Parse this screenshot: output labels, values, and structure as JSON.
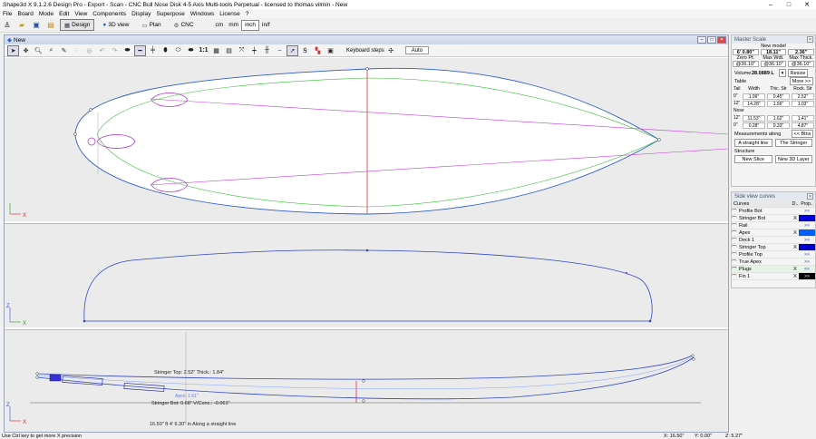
{
  "window": {
    "title": "Shape3d X 9.1.2.6 Design Pro - Export - Scan - CNC Bull Nose Disk 4-5 Axis Multi-tools Perpetual - licensed to thomas vilmin - New",
    "minimize": "–",
    "maximize": "□",
    "close": "✕"
  },
  "menu": [
    "File",
    "Board",
    "Mode",
    "Edit",
    "View",
    "Components",
    "Display",
    "Superpose",
    "Windows",
    "License",
    "?"
  ],
  "toolbar": {
    "modes": [
      {
        "label": "Design",
        "icon": "design-icon",
        "active": true
      },
      {
        "label": "3D view",
        "icon": "globe-icon",
        "active": false
      },
      {
        "label": "Plan",
        "icon": "plan-icon",
        "active": false
      },
      {
        "label": "CNC",
        "icon": "cnc-icon",
        "active": false
      }
    ],
    "units": [
      {
        "label": "cm",
        "active": false
      },
      {
        "label": "mm",
        "active": false
      },
      {
        "label": "inch",
        "active": true
      },
      {
        "label": "in/f",
        "active": false
      }
    ]
  },
  "document": {
    "tab_label": "New",
    "scale_label": "1:1",
    "keyboard_steps_label": "Keyboard steps",
    "auto_label": "Auto"
  },
  "views": {
    "outline_axis": "X",
    "profile_axis_x": "X",
    "profile_axis_z": "Z",
    "rocker_axis_x": "X",
    "rocker_axis_z": "Z",
    "rocker_text_top": "Stringer Top: 2.52\" Thick.: 1.84\"",
    "rocker_text_apex": "Apex: 1.61\"",
    "rocker_text_bot": "Stringer Bot: 0.68\" V/Conc.: -0.061\"",
    "rocker_footer": "16.50\" ft 4' 6.30\" in Along a straight line"
  },
  "master_scale": {
    "title": "Master Scale",
    "new_model": "New model",
    "values": [
      {
        "label": "Zero Pt.",
        "value": "6' 0.80\"",
        "sub": "@36.10\""
      },
      {
        "label": "Max Wdt.",
        "value": "18.11\"",
        "sub": "@36.10\""
      },
      {
        "label": "Max Thick.",
        "value": "2.36\"",
        "sub": "@36.10\""
      }
    ],
    "volume_label": "Volume",
    "volume_value": "28.0889 L",
    "resize": "Resize",
    "table_label": "Table",
    "more": "More >>",
    "tail_label": "Tail",
    "col_width": "Width",
    "col_thick": "Thic. Str",
    "col_rock": "Rock. Str",
    "tail_rows": [
      {
        "pos": "0\"",
        "w": "1.99\"",
        "t": "0.45\"",
        "r": "2.52\""
      },
      {
        "pos": "12\"",
        "w": "14.28\"",
        "t": "1.56\"",
        "r": "1.03\""
      }
    ],
    "nose_label": "Nose",
    "nose_rows": [
      {
        "pos": "12\"",
        "w": "11.53\"",
        "t": "1.62\"",
        "r": "1.41\""
      },
      {
        "pos": "0\"",
        "w": "0.28\"",
        "t": "0.33\"",
        "r": "4.87\""
      }
    ],
    "less": "<< Btns",
    "measure_label": "Measurements along",
    "straight_line": "A straight line",
    "the_stringer": "The Stringer",
    "structure_label": "Structure",
    "new_slice": "New Slice",
    "new_3d_layer": "New 3D Layer"
  },
  "side_curves": {
    "title": "Side view curves",
    "col_curves": "Curves",
    "col_d": "D..",
    "col_p": "Prop..",
    "rows": [
      {
        "name": "Profile Bot",
        "d": "",
        "p": ">>",
        "color": ""
      },
      {
        "name": "Stringer Bot",
        "d": "X",
        "p": "",
        "color": "#0000dd"
      },
      {
        "name": "Rail",
        "d": "",
        "p": ">>",
        "color": ""
      },
      {
        "name": "Apex",
        "d": "X",
        "p": "",
        "color": "#0060ff"
      },
      {
        "name": "Deck 1",
        "d": "",
        "p": ">>",
        "color": ""
      },
      {
        "name": "Stringer Top",
        "d": "X",
        "p": "",
        "color": "#0000cc"
      },
      {
        "name": "Profile Top",
        "d": "",
        "p": ">>",
        "color": ""
      },
      {
        "name": "True Apex",
        "d": "",
        "p": ">>",
        "color": ""
      },
      {
        "name": "Plugs",
        "d": "X",
        "p": "<<",
        "color": ""
      },
      {
        "name": "Fin 1",
        "d": "X",
        "p": ">>",
        "color": "#000000"
      }
    ]
  },
  "status": {
    "message": "Use Ctrl key to get more X precision",
    "x": "X: 16.50\"",
    "y": "Y: 0.00\"",
    "z": "Z: 5.27\""
  }
}
